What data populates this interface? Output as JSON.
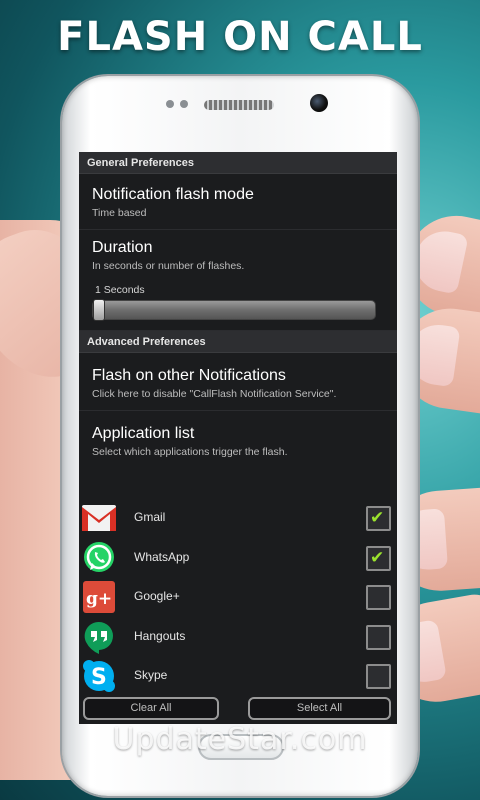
{
  "banner_title": "FLASH ON CALL",
  "watermark": "UpdateStar.com",
  "general": {
    "header": "General Preferences",
    "notification_mode": {
      "title": "Notification flash mode",
      "subtitle": "Time based"
    },
    "duration": {
      "title": "Duration",
      "subtitle": "In seconds or number of flashes.",
      "slider_value": "1 Seconds",
      "slider_fraction": 0.0
    }
  },
  "advanced": {
    "header": "Advanced Preferences",
    "other_notifications": {
      "title": "Flash on other Notifications",
      "subtitle": "Click here to disable \"CallFlash Notification Service\"."
    },
    "application_list": {
      "title": "Application list",
      "subtitle": "Select which applications trigger the flash."
    }
  },
  "apps": [
    {
      "name": "Gmail",
      "icon": "gmail-icon",
      "checked": true
    },
    {
      "name": "WhatsApp",
      "icon": "whatsapp-icon",
      "checked": true
    },
    {
      "name": "Google+",
      "icon": "google-plus-icon",
      "checked": false
    },
    {
      "name": "Hangouts",
      "icon": "hangouts-icon",
      "checked": false
    },
    {
      "name": "Skype",
      "icon": "skype-icon",
      "checked": false
    }
  ],
  "buttons": {
    "clear_all": "Clear All",
    "select_all": "Select All"
  },
  "colors": {
    "check": "#9be22d",
    "background": "#1b1c1e"
  }
}
